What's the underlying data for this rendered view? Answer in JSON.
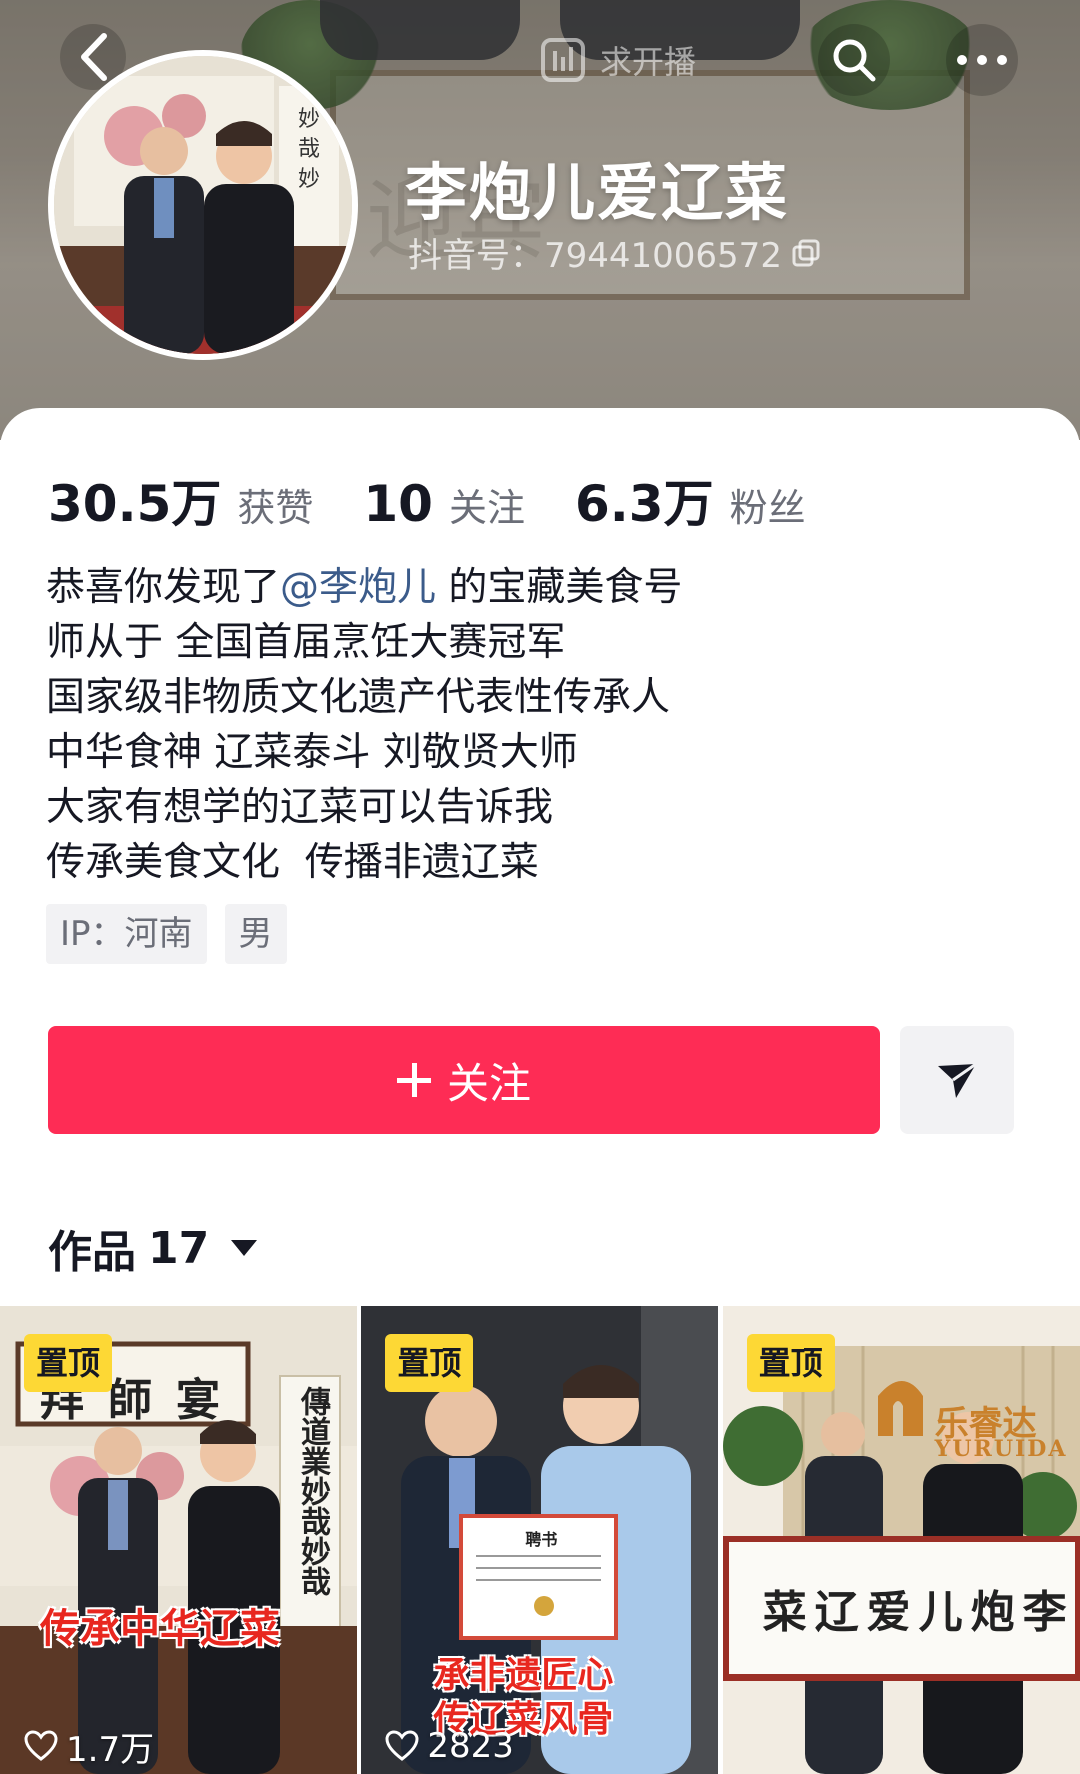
{
  "header": {
    "live_request_label": "求开播",
    "nickname": "李炮儿爱辽菜",
    "douyin_id": "抖音号：79441006572"
  },
  "stats": [
    {
      "value": "30.5万",
      "label": "获赞"
    },
    {
      "value": "10",
      "label": "关注"
    },
    {
      "value": "6.3万",
      "label": "粉丝"
    }
  ],
  "bio": {
    "line1_prefix": "恭喜你发现了",
    "line1_mention": "@李炮儿",
    "line1_suffix": " 的宝藏美食号",
    "line2": "师从于 全国首届烹饪大赛冠军",
    "line3": "国家级非物质文化遗产代表性传承人",
    "line4": "中华食神 辽菜泰斗 刘敬贤大师",
    "line5": "大家有想学的辽菜可以告诉我",
    "line6": "传承美食文化  传播非遗辽菜"
  },
  "tags": [
    "IP：河南",
    "男"
  ],
  "actions": {
    "follow_label": "关注"
  },
  "works": {
    "label": "作品",
    "count": "17",
    "videos": [
      {
        "pin": "置顶",
        "likes": "1.7万",
        "overlay": "传承中华辽菜",
        "plaque": "拜師宴",
        "scroll": "傳道業妙哉妙哉"
      },
      {
        "pin": "置顶",
        "likes": "2823",
        "overlay_line1": "承非遗匠心",
        "overlay_line2": "传辽菜风骨",
        "certificate_title": "聘书"
      },
      {
        "pin": "置顶",
        "likes": "",
        "brand": "乐睿达",
        "brand_en": "YURUIDA",
        "banner": "菜辽爱儿炮李"
      }
    ]
  },
  "colors": {
    "primary_red": "#fe2c55",
    "pin_yellow": "#fdd835",
    "mention_blue": "#3b5b8a"
  }
}
